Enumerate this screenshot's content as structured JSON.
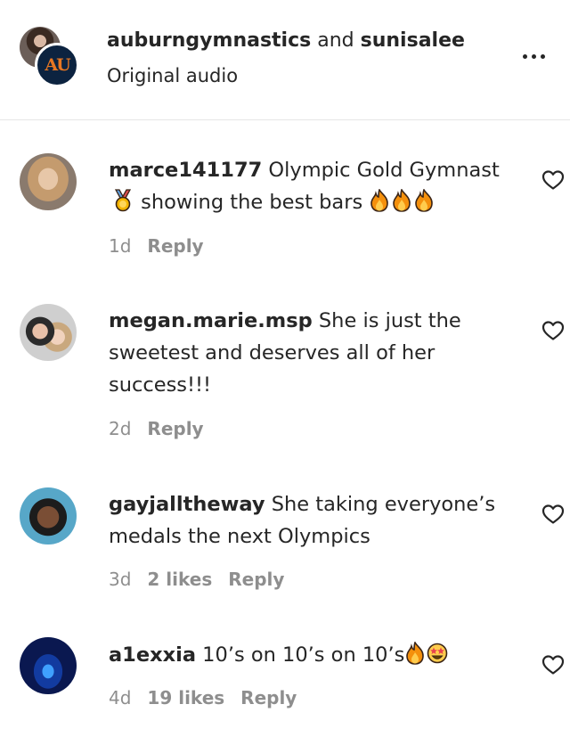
{
  "post": {
    "user1": "auburngymnastics",
    "conjunction": " and ",
    "user2": "sunisalee",
    "audio": "Original audio",
    "avatar_badge": "AU"
  },
  "comments": [
    {
      "username": "marce141177",
      "text_a": " Olympic Gold Gymnast",
      "text_b": " showing the best bars ",
      "time": "1d",
      "reply": "Reply"
    },
    {
      "username": "megan.marie.msp",
      "text": " She is just the sweetest and deserves all of her success!!!",
      "time": "2d",
      "reply": "Reply"
    },
    {
      "username": "gayjalltheway",
      "text": " She taking everyone’s medals the next Olympics",
      "time": "3d",
      "likes": "2 likes",
      "reply": "Reply"
    },
    {
      "username": "a1exxia",
      "text": " 10’s on 10’s on 10’s",
      "time": "4d",
      "likes": "19 likes",
      "reply": "Reply"
    }
  ],
  "icons": {
    "more": "more-options-icon",
    "heart": "heart-icon",
    "medal": "gold-medal-emoji",
    "fire": "fire-emoji",
    "star_eyes": "star-struck-emoji"
  },
  "colors": {
    "text": "#262626",
    "meta": "#8e8e8e",
    "divider": "#e6e6e6",
    "auburn_navy": "#0c2340",
    "auburn_orange": "#e87722"
  }
}
